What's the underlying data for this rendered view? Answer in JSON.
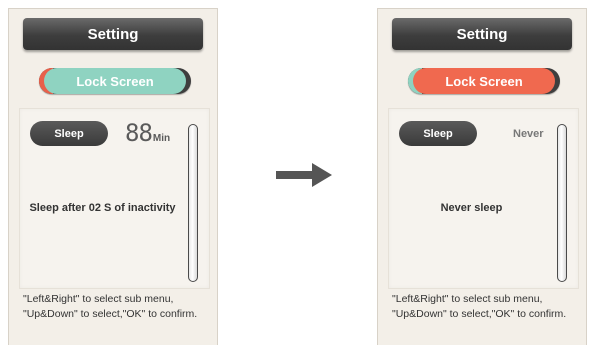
{
  "colors": {
    "device_bg": "#f3efe8",
    "title_bar": "#3d3d3d",
    "left_pill": "#8fd3c1",
    "left_pill_edge": "#e8604a",
    "right_pill": "#f0694f",
    "right_pill_edge": "#8fd3c1",
    "pill_outline": "#3e3e3e",
    "arrow": "#555555"
  },
  "arrow_icon": "right-arrow-icon",
  "left_screen": {
    "title": "Setting",
    "tab_label": "Lock Screen",
    "sleep_label": "Sleep",
    "value": "88",
    "unit": "Min",
    "description": "Sleep after 02 S of inactivity",
    "hint_line1": "\"Left&Right\" to select sub menu,",
    "hint_line2": "\"Up&Down\" to select,\"OK\" to confirm."
  },
  "right_screen": {
    "title": "Setting",
    "tab_label": "Lock Screen",
    "sleep_label": "Sleep",
    "value": "Never",
    "description": "Never sleep",
    "hint_line1": "\"Left&Right\" to select sub menu,",
    "hint_line2": "\"Up&Down\" to select,\"OK\" to confirm."
  }
}
